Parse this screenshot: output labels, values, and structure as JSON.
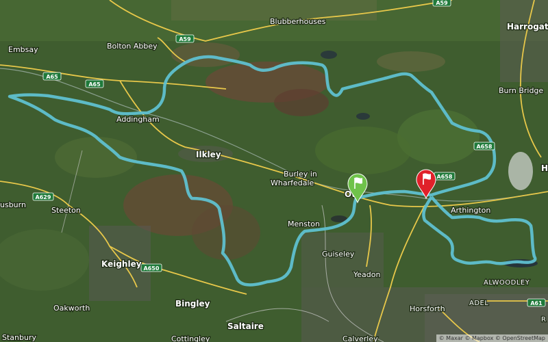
{
  "places": {
    "harrogate": "Harrogat",
    "blubberhouses": "Blubberhouses",
    "embsay": "Embsay",
    "bolton_abbey": "Bolton Abbey",
    "burn_bridge": "Burn Bridge",
    "addingham": "Addingham",
    "ilkley": "Ilkley",
    "burley_1": "Burley in",
    "burley_2": "Wharfedale",
    "otley": "Ot",
    "menston": "Menston",
    "guiseley": "Guiseley",
    "yeadon": "Yeadon",
    "arthington": "Arthington",
    "alwoodley": "ALWOODLEY",
    "adel": "ADEL",
    "horsforth": "Horsforth",
    "bingley": "Bingley",
    "saltaire": "Saltaire",
    "keighley": "Keighley",
    "oakworth": "Oakworth",
    "steeton": "Steeton",
    "cowling_partial": "usburn",
    "stanbury": "Stanbury",
    "cottingley": "Cottingley",
    "calverley": "Calverley",
    "edge_h": "H",
    "edge_r": "R"
  },
  "roads": {
    "a59_top": "A59",
    "a59_mid": "A59",
    "a65_left": "A65",
    "a65_right": "A65",
    "a629": "A629",
    "a650": "A650",
    "a658_upper": "A658",
    "a658_lower": "A658",
    "a61": "A61"
  },
  "markers": {
    "start": "start-flag-marker",
    "finish": "finish-flag-marker"
  },
  "colors": {
    "route": "#5fc0d0",
    "road_major": "#e8c84a",
    "start_pin": "#6fc24a",
    "finish_pin": "#e0212a",
    "shield": "#1f7a3a"
  },
  "attribution": "© Maxar © Mapbox © OpenStreetMap"
}
